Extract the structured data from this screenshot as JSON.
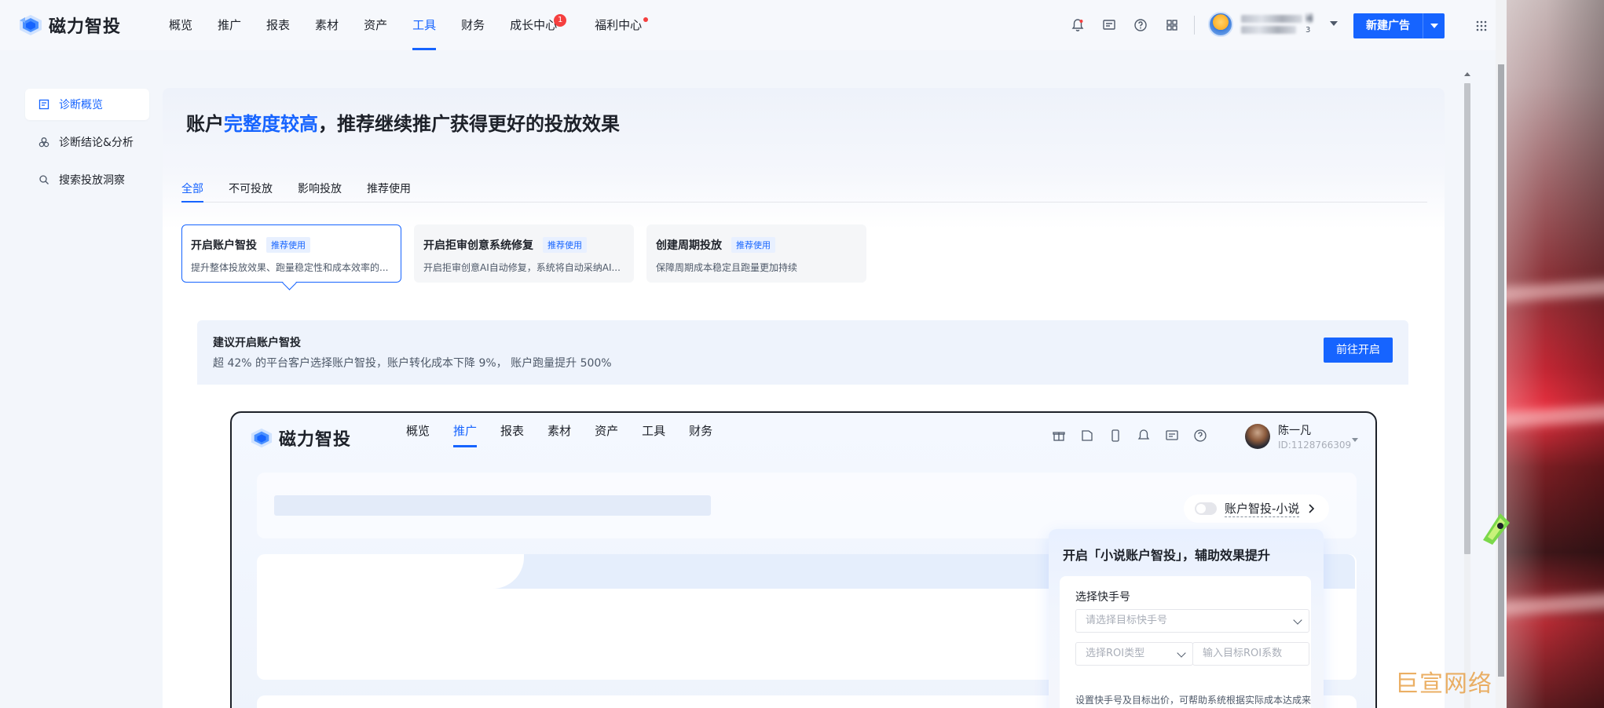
{
  "brand": {
    "name": "磁力智投"
  },
  "nav": {
    "items": [
      {
        "label": "概览"
      },
      {
        "label": "推广"
      },
      {
        "label": "报表"
      },
      {
        "label": "素材"
      },
      {
        "label": "资产"
      },
      {
        "label": "工具"
      },
      {
        "label": "财务"
      },
      {
        "label": "成长中心",
        "badge": "1"
      },
      {
        "label": "福利中心"
      }
    ],
    "active": "工具"
  },
  "header_icons": [
    "bell-icon",
    "message-icon",
    "help-icon",
    "app-grid-icon"
  ],
  "user": {
    "name_fragment": "市",
    "id_fragment": "3"
  },
  "new_ad": {
    "label": "新建广告"
  },
  "sidebar": {
    "items": [
      {
        "label": "诊断概览",
        "icon": "overview-icon"
      },
      {
        "label": "诊断结论&分析",
        "icon": "analysis-icon"
      },
      {
        "label": "搜索投放洞察",
        "icon": "search-icon"
      }
    ],
    "active": "诊断概览"
  },
  "headline": {
    "prefix": "账户",
    "highlight": "完整度较高",
    "suffix": "，推荐继续推广获得更好的投放效果"
  },
  "tabs": [
    {
      "label": "全部"
    },
    {
      "label": "不可投放"
    },
    {
      "label": "影响投放"
    },
    {
      "label": "推荐使用"
    }
  ],
  "cards": [
    {
      "title": "开启账户智投",
      "tag": "推荐使用",
      "desc": "提升整体投放效果、跑量稳定性和成本效率的..."
    },
    {
      "title": "开启拒审创意系统修复",
      "tag": "推荐使用",
      "desc": "开启拒审创意AI自动修复，系统将自动采纳AI..."
    },
    {
      "title": "创建周期投放",
      "tag": "推荐使用",
      "desc": "保障周期成本稳定且跑量更加持续"
    }
  ],
  "advice": {
    "title": "建议开启账户智投",
    "desc": "超 42% 的平台客户选择账户智投，账户转化成本下降 9%， 账户跑量提升 500%",
    "button": "前往开启"
  },
  "preview": {
    "brand": "磁力智投",
    "nav": [
      "概览",
      "推广",
      "报表",
      "素材",
      "资产",
      "工具",
      "财务"
    ],
    "active": "推广",
    "user_name": "陈一凡",
    "user_id": "ID:1128766309",
    "toggle_label": "账户智投-小说",
    "popover": {
      "title": "开启「小说账户智投」，辅助效果提升",
      "section_label": "选择快手号",
      "account_placeholder": "请选择目标快手号",
      "roi_type_placeholder": "选择ROI类型",
      "roi_value_placeholder": "输入目标ROI系数",
      "hint": "设置快手号及目标出价，可帮助系统根据实际成本达成来实时调控单元出价或计划日预算"
    }
  },
  "watermark": "巨宣网络",
  "colors": {
    "accent": "#1664ff",
    "badge": "#f53f3f"
  }
}
